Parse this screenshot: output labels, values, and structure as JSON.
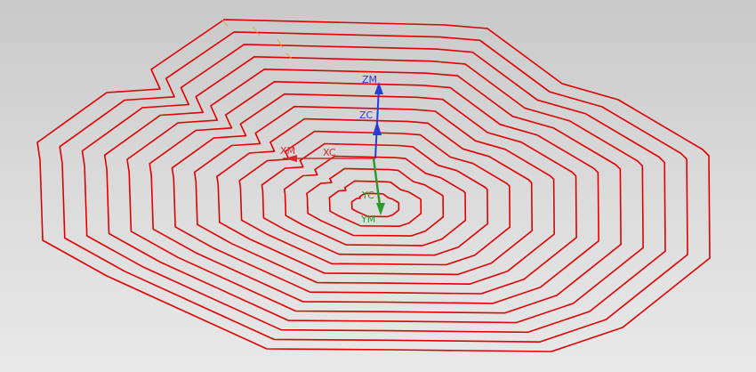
{
  "viewport": {
    "background_top": "#c9c9c9",
    "background_bottom": "#e8e8e8"
  },
  "toolpath": {
    "color": "#e00000",
    "passes": 15
  },
  "triad": {
    "zm": {
      "label": "ZM",
      "color": "#2b3bd6"
    },
    "zc": {
      "label": "ZC",
      "color": "#2b3bd6"
    },
    "xm": {
      "label": "XM",
      "color": "#d12a2a"
    },
    "xc": {
      "label": "XC",
      "color": "#d12a2a"
    },
    "yc": {
      "label": "YC",
      "color": "#2e9a2e"
    },
    "ym": {
      "label": "YM",
      "color": "#2e9a2e"
    }
  },
  "icons": [
    "mcs-orient-icon"
  ]
}
